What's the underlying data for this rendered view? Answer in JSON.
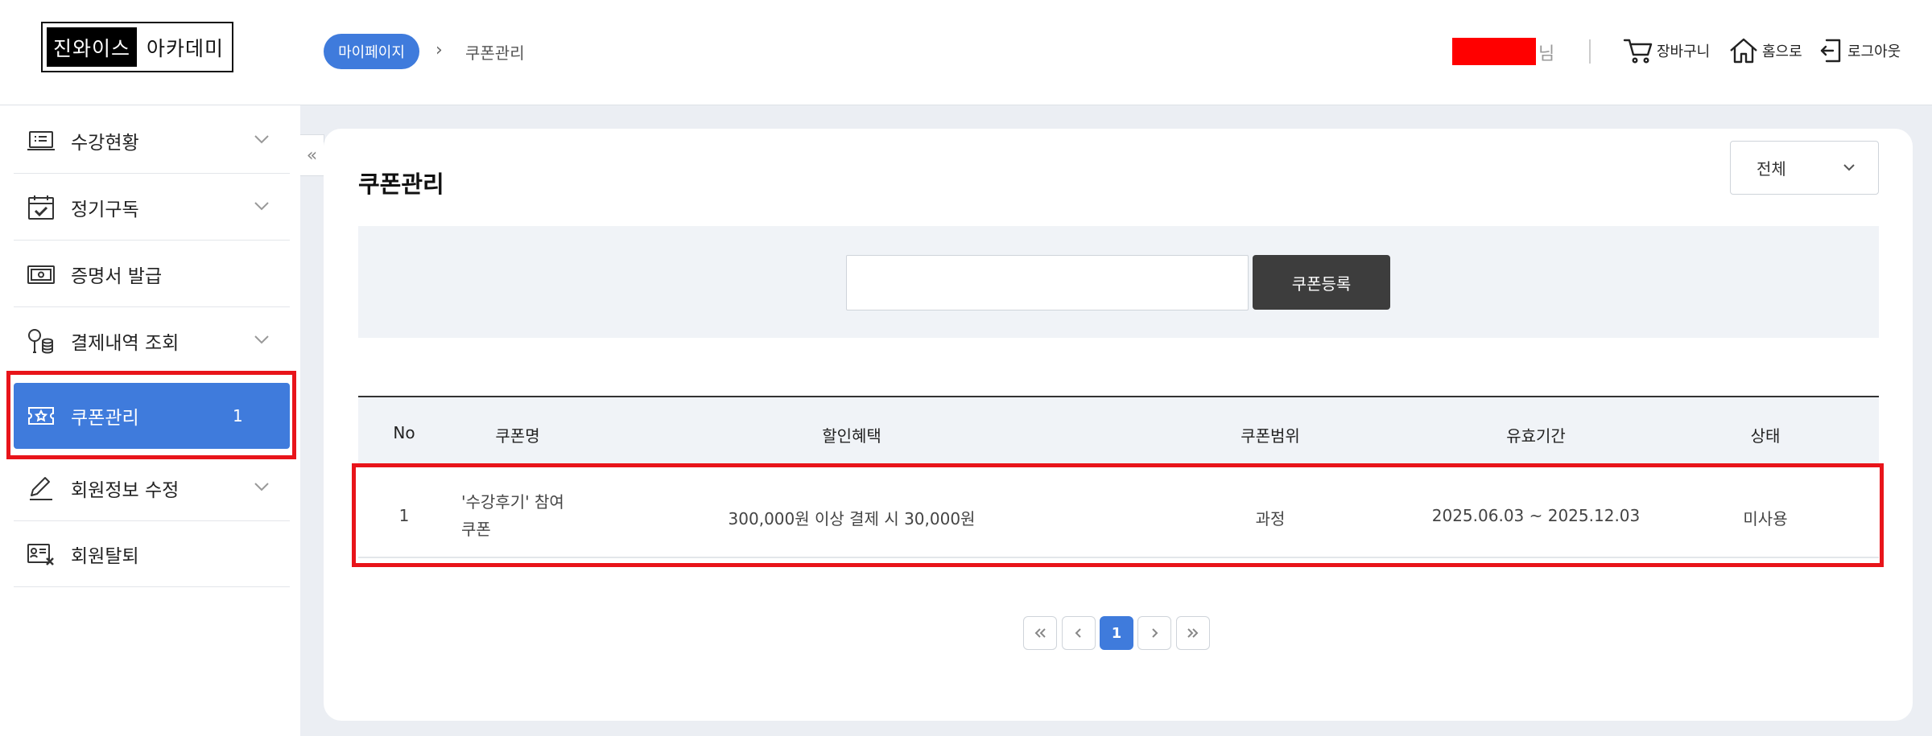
{
  "header": {
    "logo_dark": "진와이스",
    "logo_light": "아카데미",
    "breadcrumb_home": "마이페이지",
    "breadcrumb_current": "쿠폰관리",
    "user_suffix": "님",
    "links": {
      "cart": "장바구니",
      "home": "홈으로",
      "logout": "로그아웃"
    }
  },
  "sidebar": {
    "items": [
      {
        "label": "수강현황",
        "icon": "laptop-list-icon",
        "has_chevron": true
      },
      {
        "label": "정기구독",
        "icon": "calendar-check-icon",
        "has_chevron": true
      },
      {
        "label": "증명서 발급",
        "icon": "certificate-icon",
        "has_chevron": false
      },
      {
        "label": "결제내역 조회",
        "icon": "payment-coins-icon",
        "has_chevron": true
      },
      {
        "label": "쿠폰관리",
        "icon": "coupon-ticket-icon",
        "has_chevron": false,
        "count": "1",
        "active": true
      },
      {
        "label": "회원정보 수정",
        "icon": "pencil-icon",
        "has_chevron": true
      },
      {
        "label": "회원탈퇴",
        "icon": "member-remove-icon",
        "has_chevron": false
      }
    ]
  },
  "main": {
    "title": "쿠폰관리",
    "filter": {
      "selected": "전체"
    },
    "register_button": "쿠폰등록",
    "table": {
      "headers": [
        "No",
        "쿠폰명",
        "할인혜택",
        "쿠폰범위",
        "유효기간",
        "상태"
      ],
      "rows": [
        {
          "no": "1",
          "name_line1": "'수강후기' 참여",
          "name_line2": "쿠폰",
          "benefit": "300,000원 이상 결제 시 30,000원",
          "scope": "과정",
          "period": "2025.06.03 ~ 2025.12.03",
          "status": "미사용"
        }
      ]
    },
    "pagination": {
      "current": "1"
    }
  },
  "colors": {
    "accent": "#3f7bdc",
    "highlight_outline": "#e8141a",
    "redacted_user": "#ff0000",
    "dark_button": "#3d3d3d"
  }
}
